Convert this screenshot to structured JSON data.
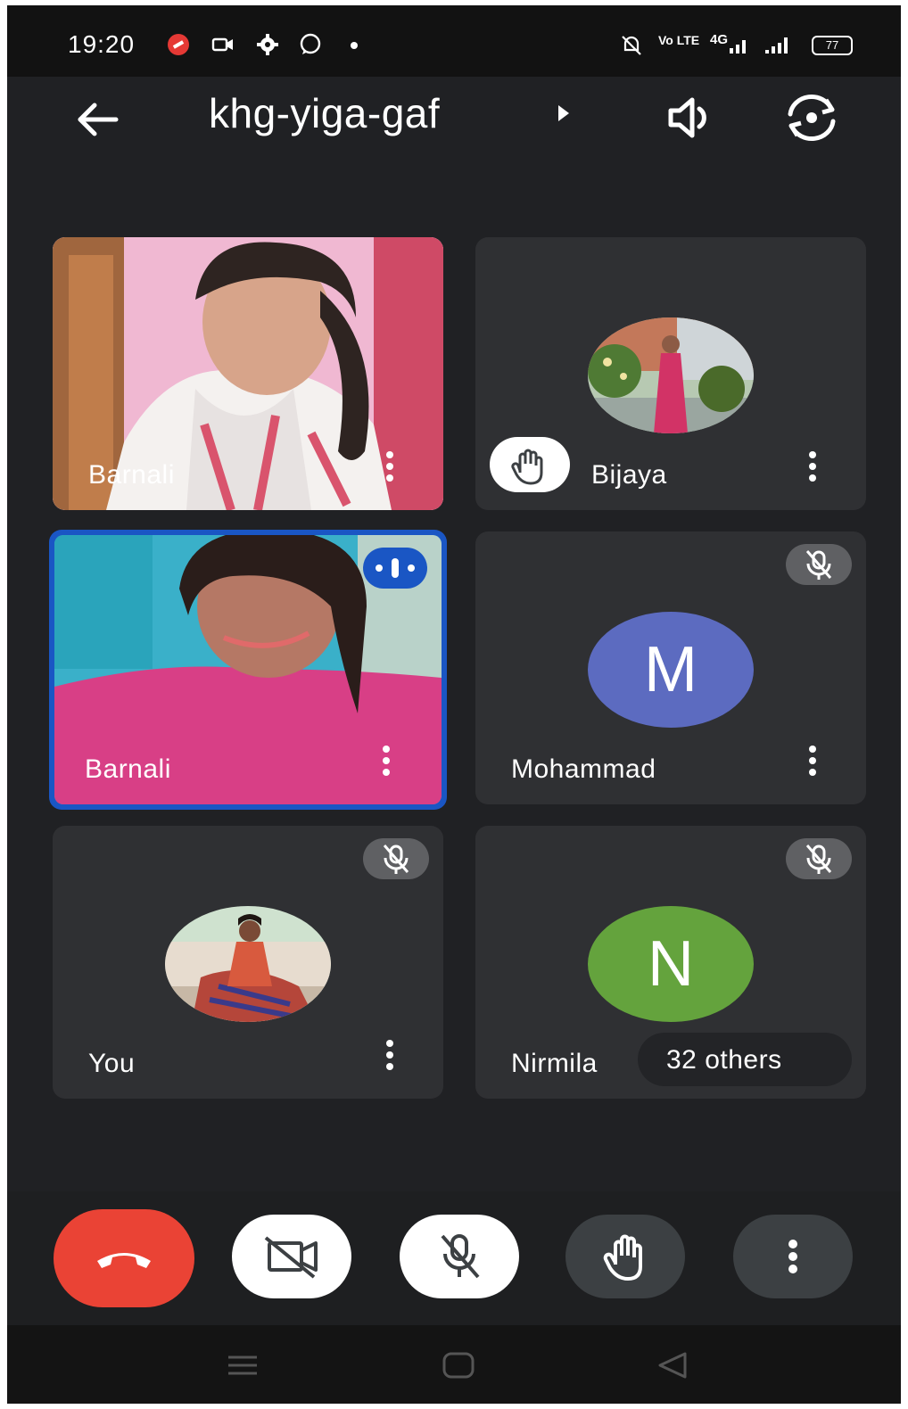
{
  "status_bar": {
    "time": "19:20",
    "network_label": "Vo LTE",
    "network_type": "4G",
    "battery": "77",
    "icons": [
      "red-app-icon",
      "video-camera-icon",
      "gear-icon",
      "whatsapp-icon",
      "dot-icon",
      "bell-mute-icon",
      "signal-icon",
      "battery-icon"
    ]
  },
  "header": {
    "meeting_code": "khg-yiga-gaf",
    "icons": [
      "back-arrow-icon",
      "caret-right-icon",
      "speaker-icon",
      "flip-camera-icon"
    ]
  },
  "tiles": [
    {
      "name": "Barnali",
      "type": "video",
      "raised_hand": false,
      "speaking": false
    },
    {
      "name": "Bijaya",
      "type": "photo-avatar",
      "raised_hand": true
    },
    {
      "name": "Barnali",
      "type": "video",
      "speaking": true
    },
    {
      "name": "Mohammad",
      "type": "letter-avatar",
      "letter": "M",
      "color": "#5c6bc0",
      "muted": true
    },
    {
      "name": "You",
      "type": "photo-avatar",
      "muted": true
    },
    {
      "name": "Nirmila",
      "type": "letter-avatar",
      "letter": "N",
      "color": "#64a33d",
      "muted": true,
      "others_label": "32 others"
    }
  ],
  "colors": {
    "background": "#202124",
    "tile": "#2f3033",
    "end_call": "#ea4335",
    "speaking_border": "#1a56c4"
  },
  "controls": [
    "end-call",
    "camera-off",
    "mic-off",
    "raise-hand",
    "more-options"
  ],
  "nav_icons": [
    "menu-icon",
    "home-icon",
    "back-icon"
  ]
}
